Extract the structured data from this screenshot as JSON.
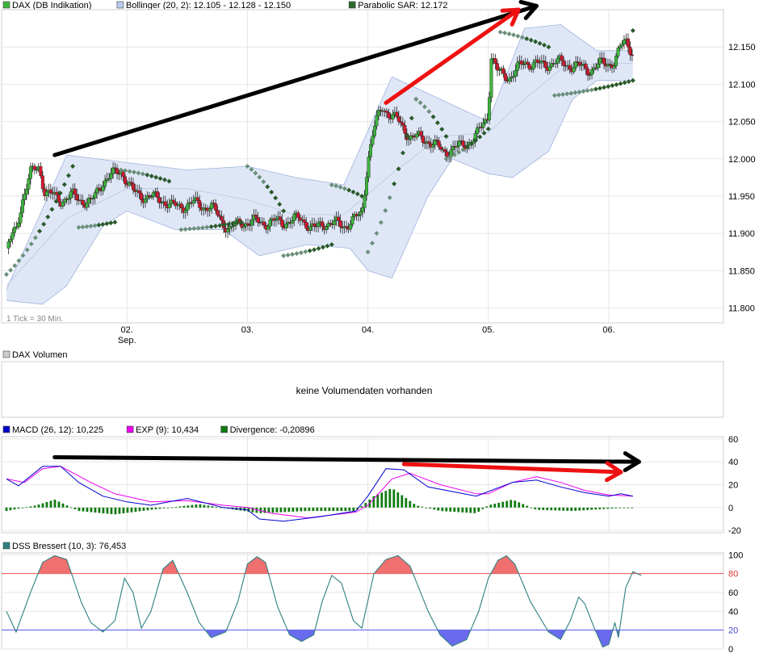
{
  "colors": {
    "up": "#3cb43c",
    "down": "#d2192d",
    "band_fill": "#dfe7f7",
    "band_line": "#9fb3dd",
    "sar": "#2a5a2a",
    "sar_old": "#6b8f7b",
    "macd": "#0000cc",
    "exp": "#ee00ee",
    "divergence": "#0f7a0f",
    "dss": "#2f7f7f",
    "overbought": "#f07070",
    "oversold": "#6a6aee"
  },
  "price_panel": {
    "legend": [
      {
        "label": "DAX (DB Indikation)",
        "swatch": "#3cb43c"
      },
      {
        "label": "Bollinger (20, 2): 12.105 - 12.128 - 12.150",
        "swatch": "#b8c8ee"
      },
      {
        "label": "Parabolic SAR: 12.172",
        "swatch": "#2a6a2a"
      }
    ],
    "tick_note": "1 Tick = 30 Min."
  },
  "volume_panel": {
    "legend": [
      {
        "label": "DAX Volumen",
        "swatch": "#cccccc"
      }
    ],
    "message": "keine Volumendaten vorhanden"
  },
  "macd_panel": {
    "legend": [
      {
        "label": "MACD (26, 12): 10,225",
        "swatch": "#0000cc"
      },
      {
        "label": "EXP (9): 10,434",
        "swatch": "#ee00ee"
      },
      {
        "label": "Divergence: -0,20896",
        "swatch": "#0f7a0f"
      }
    ]
  },
  "dss_panel": {
    "legend": [
      {
        "label": "DSS Bressert (10, 3): 76,453",
        "swatch": "#2f7f7f"
      }
    ]
  },
  "x_axis": {
    "labels": [
      {
        "text": "02.",
        "sub": "Sep.",
        "day": 1
      },
      {
        "text": "03.",
        "sub": "",
        "day": 2
      },
      {
        "text": "04.",
        "sub": "",
        "day": 3
      },
      {
        "text": "05.",
        "sub": "",
        "day": 4
      },
      {
        "text": "06.",
        "sub": "",
        "day": 5
      }
    ]
  },
  "chart_data": [
    {
      "type": "candlestick",
      "title": "DAX (DB Indikation)",
      "y_ticks": [
        11800,
        11850,
        11900,
        11950,
        12000,
        12050,
        12100,
        12150
      ],
      "y_tick_labels": [
        "11.800",
        "11.850",
        "11.900",
        "11.950",
        "12.000",
        "12.050",
        "12.100",
        "12.150"
      ],
      "ylim": [
        11780,
        12200
      ],
      "grid": true,
      "close_path": [
        [
          0,
          11880
        ],
        [
          0.08,
          11905
        ],
        [
          0.13,
          11945
        ],
        [
          0.2,
          11980
        ],
        [
          0.27,
          11990
        ],
        [
          0.32,
          11955
        ],
        [
          0.45,
          11945
        ],
        [
          0.55,
          11950
        ],
        [
          0.7,
          11940
        ],
        [
          0.8,
          11970
        ],
        [
          0.9,
          11980
        ],
        [
          0.95,
          11985
        ],
        [
          1.05,
          11955
        ],
        [
          1.15,
          11950
        ],
        [
          1.3,
          11945
        ],
        [
          1.38,
          11935
        ],
        [
          1.55,
          11940
        ],
        [
          1.7,
          11935
        ],
        [
          1.85,
          11905
        ],
        [
          1.95,
          11915
        ],
        [
          2.05,
          11915
        ],
        [
          2.3,
          11915
        ],
        [
          2.45,
          11920
        ],
        [
          2.55,
          11905
        ],
        [
          2.65,
          11915
        ],
        [
          2.8,
          11910
        ],
        [
          2.95,
          11925
        ],
        [
          3.0,
          12000
        ],
        [
          3.05,
          12040
        ],
        [
          3.12,
          12070
        ],
        [
          3.25,
          12050
        ],
        [
          3.35,
          12030
        ],
        [
          3.5,
          12025
        ],
        [
          3.62,
          12010
        ],
        [
          3.75,
          12015
        ],
        [
          3.9,
          12030
        ],
        [
          4.0,
          12060
        ],
        [
          4.02,
          12140
        ],
        [
          4.08,
          12115
        ],
        [
          4.18,
          12110
        ],
        [
          4.3,
          12130
        ],
        [
          4.45,
          12125
        ],
        [
          4.55,
          12130
        ],
        [
          4.7,
          12125
        ],
        [
          4.85,
          12120
        ],
        [
          4.95,
          12128
        ],
        [
          5.05,
          12130
        ],
        [
          5.1,
          12150
        ],
        [
          5.15,
          12160
        ],
        [
          5.2,
          12140
        ]
      ],
      "bollinger": {
        "upper_path": [
          [
            0,
            11825
          ],
          [
            0.5,
            12005
          ],
          [
            1.0,
            11995
          ],
          [
            1.5,
            11985
          ],
          [
            2.0,
            11990
          ],
          [
            2.4,
            11975
          ],
          [
            2.8,
            11965
          ],
          [
            3.2,
            12110
          ],
          [
            3.6,
            12080
          ],
          [
            4.0,
            12050
          ],
          [
            4.3,
            12175
          ],
          [
            4.6,
            12180
          ],
          [
            4.9,
            12145
          ],
          [
            5.2,
            12145
          ]
        ],
        "middle_path": [
          [
            0,
            11830
          ],
          [
            0.5,
            11920
          ],
          [
            1.0,
            11960
          ],
          [
            1.5,
            11960
          ],
          [
            2.0,
            11945
          ],
          [
            2.4,
            11925
          ],
          [
            2.8,
            11925
          ],
          [
            3.2,
            11980
          ],
          [
            3.6,
            12030
          ],
          [
            4.0,
            12035
          ],
          [
            4.3,
            12080
          ],
          [
            4.6,
            12120
          ],
          [
            4.9,
            12128
          ],
          [
            5.2,
            12128
          ]
        ],
        "lower_path": [
          [
            0,
            11810
          ],
          [
            0.3,
            11805
          ],
          [
            0.5,
            11830
          ],
          [
            0.8,
            11910
          ],
          [
            1.0,
            11930
          ],
          [
            1.4,
            11905
          ],
          [
            1.8,
            11905
          ],
          [
            2.1,
            11870
          ],
          [
            2.5,
            11885
          ],
          [
            2.85,
            11880
          ],
          [
            3.0,
            11850
          ],
          [
            3.2,
            11840
          ],
          [
            3.5,
            11950
          ],
          [
            3.7,
            12000
          ],
          [
            4.0,
            11980
          ],
          [
            4.2,
            11975
          ],
          [
            4.5,
            12010
          ],
          [
            4.7,
            12080
          ],
          [
            4.9,
            12105
          ],
          [
            5.2,
            12105
          ]
        ]
      },
      "parabolic_sar_segments": [
        {
          "from": 0.0,
          "to": 0.55,
          "y_from": 11845,
          "y_to": 11990
        },
        {
          "from": 0.6,
          "to": 0.9,
          "y_from": 11908,
          "y_to": 11915
        },
        {
          "from": 0.95,
          "to": 1.35,
          "y_from": 11985,
          "y_to": 11970
        },
        {
          "from": 1.45,
          "to": 1.95,
          "y_from": 11905,
          "y_to": 11915
        },
        {
          "from": 2.0,
          "to": 2.3,
          "y_from": 11990,
          "y_to": 11930
        },
        {
          "from": 2.3,
          "to": 2.7,
          "y_from": 11870,
          "y_to": 11885
        },
        {
          "from": 2.7,
          "to": 2.95,
          "y_from": 11965,
          "y_to": 11950
        },
        {
          "from": 3.0,
          "to": 3.4,
          "y_from": 11875,
          "y_to": 12080
        },
        {
          "from": 3.4,
          "to": 3.65,
          "y_from": 12080,
          "y_to": 12030
        },
        {
          "from": 3.65,
          "to": 4.0,
          "y_from": 12000,
          "y_to": 12040
        },
        {
          "from": 4.1,
          "to": 4.5,
          "y_from": 12170,
          "y_to": 12150
        },
        {
          "from": 4.55,
          "to": 5.2,
          "y_from": 12085,
          "y_to": 12105
        }
      ],
      "sar_last": 12172,
      "annotations": [
        {
          "type": "arrow",
          "color": "#000000",
          "from": [
            0.4,
            12005
          ],
          "to": [
            4.4,
            12205
          ]
        },
        {
          "type": "arrow",
          "color": "#ee1111",
          "from": [
            3.15,
            12075
          ],
          "to": [
            4.25,
            12200
          ]
        }
      ]
    },
    {
      "type": "line",
      "title": "MACD",
      "y_ticks": [
        60,
        40,
        20,
        0,
        -20
      ],
      "ylim": [
        -22,
        62
      ],
      "series": [
        {
          "name": "MACD (26, 12)",
          "path": [
            [
              0,
              25
            ],
            [
              0.1,
              19
            ],
            [
              0.3,
              36
            ],
            [
              0.45,
              36
            ],
            [
              0.6,
              22
            ],
            [
              0.8,
              10
            ],
            [
              1.0,
              5
            ],
            [
              1.2,
              2
            ],
            [
              1.5,
              8
            ],
            [
              1.8,
              0
            ],
            [
              2.0,
              -2
            ],
            [
              2.1,
              -10
            ],
            [
              2.3,
              -12
            ],
            [
              2.6,
              -8
            ],
            [
              2.9,
              -3
            ],
            [
              3.0,
              10
            ],
            [
              3.15,
              34
            ],
            [
              3.3,
              33
            ],
            [
              3.5,
              18
            ],
            [
              3.7,
              14
            ],
            [
              3.9,
              10
            ],
            [
              4.0,
              14
            ],
            [
              4.2,
              22
            ],
            [
              4.4,
              24
            ],
            [
              4.6,
              18
            ],
            [
              4.8,
              13
            ],
            [
              5.0,
              10
            ],
            [
              5.1,
              12
            ],
            [
              5.2,
              10
            ]
          ]
        },
        {
          "name": "EXP (9)",
          "path": [
            [
              0,
              25
            ],
            [
              0.15,
              22
            ],
            [
              0.3,
              34
            ],
            [
              0.45,
              36
            ],
            [
              0.7,
              22
            ],
            [
              0.9,
              12
            ],
            [
              1.2,
              5
            ],
            [
              1.5,
              6
            ],
            [
              1.8,
              2
            ],
            [
              2.0,
              0
            ],
            [
              2.2,
              -5
            ],
            [
              2.5,
              -9
            ],
            [
              2.9,
              -4
            ],
            [
              3.0,
              2
            ],
            [
              3.2,
              25
            ],
            [
              3.35,
              30
            ],
            [
              3.6,
              20
            ],
            [
              3.9,
              12
            ],
            [
              4.0,
              12
            ],
            [
              4.2,
              22
            ],
            [
              4.4,
              27
            ],
            [
              4.6,
              22
            ],
            [
              4.8,
              15
            ],
            [
              5.0,
              11
            ],
            [
              5.2,
              10
            ]
          ]
        }
      ],
      "divergence_path": [
        [
          0,
          -3
        ],
        [
          0.25,
          2
        ],
        [
          0.4,
          7
        ],
        [
          0.6,
          -3
        ],
        [
          0.9,
          -6
        ],
        [
          1.2,
          -2
        ],
        [
          1.6,
          3
        ],
        [
          1.9,
          -2
        ],
        [
          2.1,
          -5
        ],
        [
          2.5,
          -3
        ],
        [
          2.9,
          -3
        ],
        [
          3.05,
          10
        ],
        [
          3.2,
          17
        ],
        [
          3.4,
          2
        ],
        [
          3.6,
          -3
        ],
        [
          3.9,
          -5
        ],
        [
          4.0,
          2
        ],
        [
          4.2,
          7
        ],
        [
          4.4,
          -2
        ],
        [
          4.7,
          -3
        ],
        [
          5.0,
          -1
        ],
        [
          5.2,
          0
        ]
      ],
      "annotations": [
        {
          "type": "arrow",
          "color": "#000000",
          "from": [
            0.4,
            44
          ],
          "to": [
            5.25,
            40
          ]
        },
        {
          "type": "arrow",
          "color": "#ee1111",
          "from": [
            3.3,
            38
          ],
          "to": [
            5.1,
            31
          ]
        }
      ]
    },
    {
      "type": "line",
      "title": "DSS Bressert (10, 3)",
      "y_ticks": [
        100,
        80,
        60,
        40,
        20,
        0
      ],
      "ylim": [
        0,
        102
      ],
      "reference_lines": [
        80,
        20
      ],
      "series": [
        {
          "name": "DSS Bressert (10, 3)",
          "path": [
            [
              0,
              40
            ],
            [
              0.08,
              18
            ],
            [
              0.2,
              60
            ],
            [
              0.3,
              92
            ],
            [
              0.4,
              99
            ],
            [
              0.5,
              95
            ],
            [
              0.62,
              50
            ],
            [
              0.7,
              28
            ],
            [
              0.8,
              18
            ],
            [
              0.9,
              30
            ],
            [
              0.98,
              75
            ],
            [
              1.05,
              60
            ],
            [
              1.12,
              22
            ],
            [
              1.2,
              40
            ],
            [
              1.3,
              85
            ],
            [
              1.38,
              94
            ],
            [
              1.5,
              60
            ],
            [
              1.6,
              28
            ],
            [
              1.7,
              12
            ],
            [
              1.82,
              18
            ],
            [
              1.92,
              50
            ],
            [
              2.0,
              90
            ],
            [
              2.08,
              98
            ],
            [
              2.15,
              92
            ],
            [
              2.25,
              45
            ],
            [
              2.35,
              15
            ],
            [
              2.45,
              8
            ],
            [
              2.55,
              15
            ],
            [
              2.62,
              50
            ],
            [
              2.7,
              78
            ],
            [
              2.78,
              70
            ],
            [
              2.88,
              30
            ],
            [
              2.95,
              22
            ],
            [
              3.05,
              80
            ],
            [
              3.15,
              95
            ],
            [
              3.25,
              99
            ],
            [
              3.35,
              88
            ],
            [
              3.5,
              40
            ],
            [
              3.6,
              15
            ],
            [
              3.7,
              3
            ],
            [
              3.82,
              10
            ],
            [
              3.92,
              40
            ],
            [
              4.0,
              75
            ],
            [
              4.08,
              94
            ],
            [
              4.15,
              99
            ],
            [
              4.22,
              90
            ],
            [
              4.35,
              50
            ],
            [
              4.5,
              18
            ],
            [
              4.6,
              10
            ],
            [
              4.68,
              30
            ],
            [
              4.75,
              55
            ],
            [
              4.8,
              48
            ],
            [
              4.88,
              22
            ],
            [
              4.95,
              2
            ],
            [
              5.0,
              5
            ],
            [
              5.05,
              28
            ],
            [
              5.08,
              12
            ],
            [
              5.14,
              65
            ],
            [
              5.2,
              82
            ],
            [
              5.27,
              78
            ]
          ]
        }
      ],
      "last_value": 76.453
    }
  ]
}
